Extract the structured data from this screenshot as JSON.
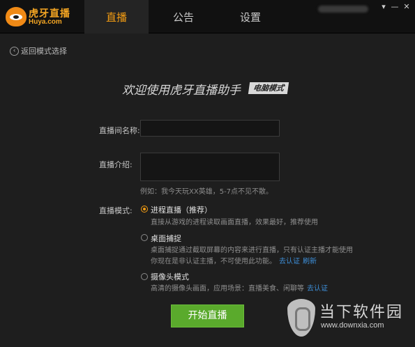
{
  "logo": {
    "text_cn": "虎牙直播",
    "text_en": "Huya.com"
  },
  "tabs": [
    {
      "label": "直播",
      "active": true
    },
    {
      "label": "公告",
      "active": false
    },
    {
      "label": "设置",
      "active": false
    }
  ],
  "window_controls": {
    "menu": "▾",
    "minimize": "—",
    "close": "✕"
  },
  "back": {
    "icon": "back-arrow-icon",
    "label": "返回模式选择"
  },
  "headline": "欢迎使用虎牙直播助手",
  "mode_badge": "电脑模式",
  "form": {
    "room_name_label": "直播间名称:",
    "room_name_value": "",
    "intro_label": "直播介绍:",
    "intro_value": "",
    "intro_example": "例如：我今天玩XX英雄，5-7点不见不散。",
    "mode_label": "直播模式:"
  },
  "modes": [
    {
      "title": "进程直播（推荐）",
      "selected": true,
      "desc": "直接从游戏的进程读取画面直播，效果最好，推荐使用"
    },
    {
      "title": "桌面捕捉",
      "selected": false,
      "desc": "桌面捕捉通过截取屏幕的内容来进行直播，只有认证主播才能使用",
      "desc2": "你现在是非认证主播，不可使用此功能。",
      "link1": "去认证",
      "link2": "刷新"
    },
    {
      "title": "摄像头模式",
      "selected": false,
      "desc": "高清的摄像头画面，应用场景：直播美食、闲聊等",
      "link1": "去认证"
    }
  ],
  "start_button": "开始直播",
  "watermark": {
    "text_cn": "当下软件园",
    "url": "www.downxia.com"
  },
  "colors": {
    "accent": "#f39c12",
    "start_button": "#5aaa2c",
    "link": "#3d8fd9"
  }
}
